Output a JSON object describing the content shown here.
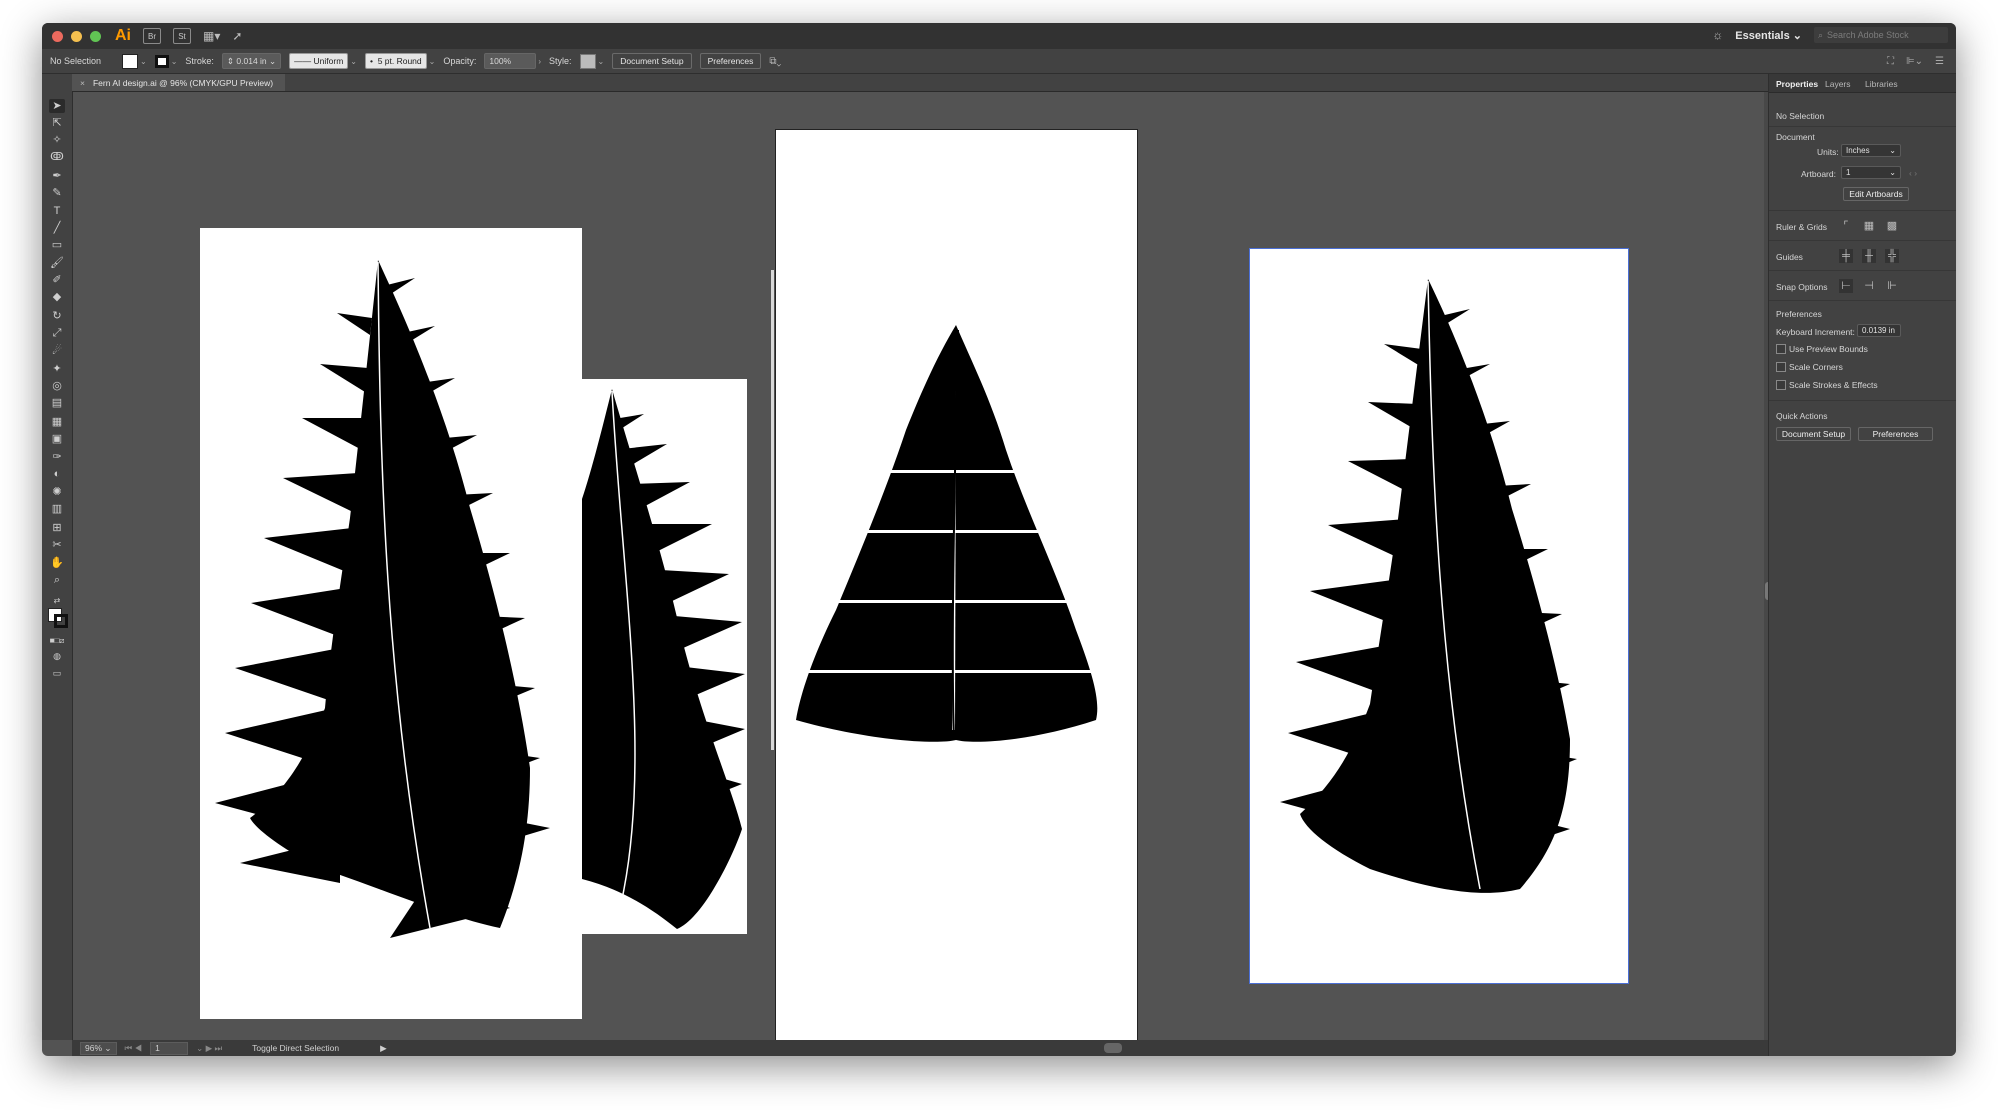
{
  "app": {
    "logo": "Ai",
    "app_buttons": [
      "Br",
      "St"
    ],
    "workspace": "Essentials",
    "search_placeholder": "Search Adobe Stock"
  },
  "control_bar": {
    "selection": "No Selection",
    "stroke_label": "Stroke:",
    "stroke_value": "0.014 in",
    "profile": "Uniform",
    "brush": "5 pt. Round",
    "opacity_label": "Opacity:",
    "opacity_value": "100%",
    "style_label": "Style:",
    "document_setup": "Document Setup",
    "preferences": "Preferences"
  },
  "document_tab": {
    "title": "Fern AI design.ai @ 96% (CMYK/GPU Preview)"
  },
  "status_bar": {
    "zoom": "96%",
    "artboard": "1",
    "message": "Toggle Direct Selection"
  },
  "properties_panel": {
    "tabs": [
      "Properties",
      "Layers",
      "Libraries"
    ],
    "selection": "No Selection",
    "document_heading": "Document",
    "units_label": "Units:",
    "units_value": "Inches",
    "artboard_label": "Artboard:",
    "artboard_value": "1",
    "edit_artboards": "Edit Artboards",
    "ruler_grids": "Ruler & Grids",
    "guides": "Guides",
    "snap_options": "Snap Options",
    "preferences_heading": "Preferences",
    "keyboard_increment_label": "Keyboard Increment:",
    "keyboard_increment_value": "0.0139 in",
    "checkboxes": [
      "Use Preview Bounds",
      "Scale Corners",
      "Scale Strokes & Effects"
    ],
    "quick_actions": "Quick Actions",
    "document_setup": "Document Setup",
    "preferences": "Preferences"
  },
  "icons": {
    "toolbar": [
      "selection-tool-icon",
      "direct-selection-tool-icon",
      "magic-wand-icon",
      "lasso-icon",
      "pen-tool-icon",
      "curvature-tool-icon",
      "type-tool-icon",
      "line-tool-icon",
      "rectangle-tool-icon",
      "paintbrush-icon",
      "shaper-tool-icon",
      "eraser-icon",
      "rotate-tool-icon",
      "scale-tool-icon",
      "warp-tool-icon",
      "puppet-warp-icon",
      "shape-builder-icon",
      "perspective-grid-icon",
      "mesh-tool-icon",
      "gradient-tool-icon",
      "eyedropper-icon",
      "blend-tool-icon",
      "symbol-sprayer-icon",
      "graph-tool-icon",
      "artboard-tool-icon",
      "slice-tool-icon",
      "hand-tool-icon",
      "zoom-tool-icon"
    ]
  },
  "colors": {
    "canvas": "#535353",
    "panel": "#424242",
    "selection_outline": "#4b6fd6",
    "artwork": "#000000"
  }
}
